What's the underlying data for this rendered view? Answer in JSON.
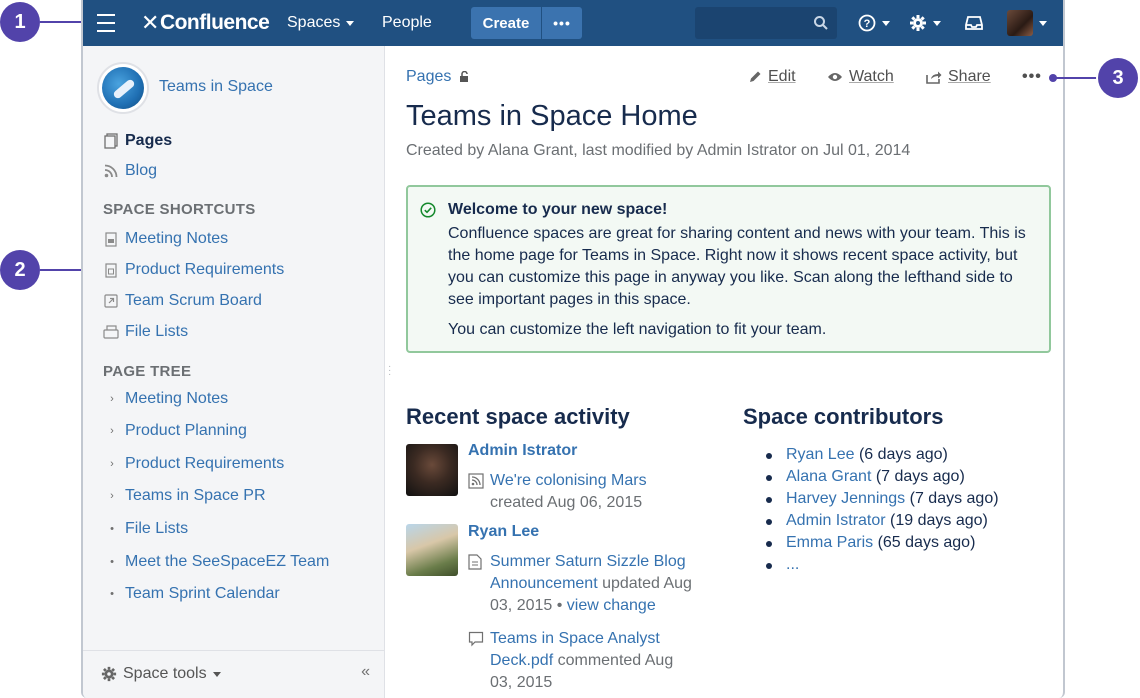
{
  "topbar": {
    "logo": "Confluence",
    "spaces_label": "Spaces",
    "people_label": "People",
    "create_label": "Create",
    "more_label": "•••"
  },
  "sidebar": {
    "space_name": "Teams in Space",
    "nav": [
      {
        "label": "Pages",
        "icon": "pages-icon"
      },
      {
        "label": "Blog",
        "icon": "rss-icon"
      }
    ],
    "shortcuts_heading": "SPACE SHORTCUTS",
    "shortcuts": [
      {
        "label": "Meeting Notes",
        "icon": "page-icon"
      },
      {
        "label": "Product Requirements",
        "icon": "page-icon"
      },
      {
        "label": "Team Scrum Board",
        "icon": "external-link-icon"
      },
      {
        "label": "File Lists",
        "icon": "files-icon"
      }
    ],
    "tree_heading": "PAGE TREE",
    "tree": [
      {
        "label": "Meeting Notes",
        "mark": "›"
      },
      {
        "label": "Product Planning",
        "mark": "›"
      },
      {
        "label": "Product Requirements",
        "mark": "›"
      },
      {
        "label": "Teams in Space PR",
        "mark": "›"
      },
      {
        "label": "File Lists",
        "mark": "•"
      },
      {
        "label": "Meet the SeeSpaceEZ Team",
        "mark": "•"
      },
      {
        "label": "Team Sprint Calendar",
        "mark": "•"
      }
    ],
    "space_tools_label": "Space tools",
    "collapse_label": "«"
  },
  "main": {
    "breadcrumb": "Pages",
    "actions": {
      "edit": "Edit",
      "watch": "Watch",
      "share": "Share",
      "more": "•••"
    },
    "title": "Teams in Space Home",
    "byline": "Created by Alana Grant, last modified by Admin Istrator on Jul 01, 2014",
    "message": {
      "title": "Welcome to your new space!",
      "body": "Confluence spaces are great for sharing content and news with your team. This is the home page for Teams in Space. Right now it shows recent space activity, but you can customize this page in anyway you like. Scan along the lefthand side to see important pages in this space.",
      "body2": "You can customize the left navigation to fit your team."
    },
    "recent_heading": "Recent space activity",
    "activity": [
      {
        "user": "Admin Istrator",
        "items": [
          {
            "link": "We're colonising Mars",
            "meta": "created Aug 06, 2015",
            "icon": "blog-icon"
          }
        ]
      },
      {
        "user": "Ryan Lee",
        "items": [
          {
            "link1": "Summer Saturn Sizzle Blog",
            "link2": "Announcement",
            "meta1": " updated Aug",
            "meta2": "03, 2015 • ",
            "extra": "view change",
            "icon": "page-icon"
          },
          {
            "link1": "Teams in Space Analyst",
            "link2": "Deck.pdf",
            "meta1": " commented Aug",
            "meta2": "03, 2015",
            "icon": "comment-icon"
          }
        ]
      }
    ],
    "contributors_heading": "Space contributors",
    "contributors": [
      {
        "name": "Ryan Lee",
        "when": " (6 days ago)"
      },
      {
        "name": "Alana Grant",
        "when": " (7 days ago)"
      },
      {
        "name": "Harvey Jennings",
        "when": " (7 days ago)"
      },
      {
        "name": "Admin Istrator",
        "when": " (19 days ago)"
      },
      {
        "name": "Emma Paris",
        "when": " (65 days ago)"
      },
      {
        "name": "...",
        "when": ""
      }
    ]
  },
  "callouts": [
    "1",
    "2",
    "3"
  ],
  "colors": {
    "topbar": "#205081",
    "link": "#3572b0",
    "callout": "#5243aa",
    "success_border": "#91c89c"
  }
}
